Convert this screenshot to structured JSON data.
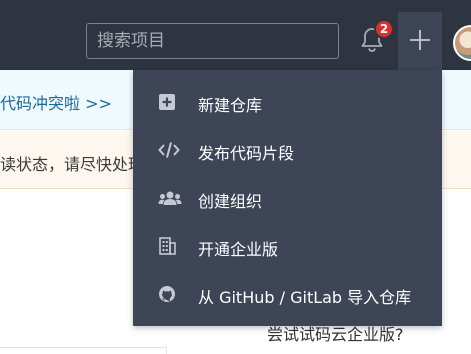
{
  "header": {
    "search_placeholder": "搜索项目",
    "notification_count": "2"
  },
  "notice": {
    "text": "代码冲突啦 >>"
  },
  "warning": {
    "text": "读状态，请尽快处理"
  },
  "dropdown": {
    "items": [
      {
        "label": "新建仓库",
        "icon": "plus-square-icon"
      },
      {
        "label": "发布代码片段",
        "icon": "code-icon"
      },
      {
        "label": "创建组织",
        "icon": "users-icon"
      },
      {
        "label": "开通企业版",
        "icon": "building-icon"
      },
      {
        "label": "从 GitHub / GitLab 导入仓库",
        "icon": "github-icon"
      }
    ]
  },
  "footer": {
    "text": "尝试试码云企业版?"
  },
  "colors": {
    "topbar": "#2e3440",
    "dropdown": "#3e4557",
    "badge": "#e02d2d",
    "link": "#1a6a99"
  }
}
